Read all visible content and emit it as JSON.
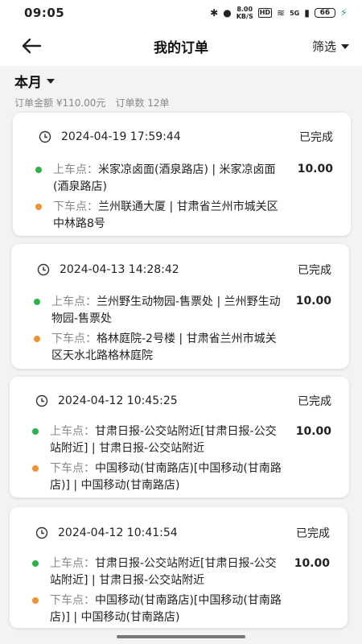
{
  "status_bar": {
    "time": "09:05",
    "net_speed_value": "8.00",
    "net_speed_unit": "KB/S",
    "hd_label": "HD",
    "signal_label": "5G",
    "battery_level": "66"
  },
  "header": {
    "title": "我的订单",
    "filter_label": "筛选"
  },
  "summary": {
    "month_label": "本月",
    "amount_text": "订单金额 ¥110.00元",
    "count_text": "订单数 12单"
  },
  "colors": {
    "pickup_dot": "#2bb34a",
    "dropoff_dot": "#f0922e"
  },
  "orders": [
    {
      "datetime": "2024-04-19 17:59:44",
      "status": "已完成",
      "pickup_label": "上车点：",
      "pickup": "米家凉卤面(酒泉路店) | 米家凉卤面(酒泉路店)",
      "dropoff_label": "下车点：",
      "dropoff": "兰州联通大厦 | 甘肃省兰州市城关区中林路8号",
      "price": "10.00"
    },
    {
      "datetime": "2024-04-13 14:28:42",
      "status": "已完成",
      "pickup_label": "上车点：",
      "pickup": "兰州野生动物园-售票处 | 兰州野生动物园-售票处",
      "dropoff_label": "下车点：",
      "dropoff": "格林庭院-2号楼 | 甘肃省兰州市城关区天水北路格林庭院",
      "price": "10.00"
    },
    {
      "datetime": "2024-04-12 10:45:25",
      "status": "已完成",
      "pickup_label": "上车点：",
      "pickup": "甘肃日报-公交站附近[甘肃日报-公交站附近] | 甘肃日报-公交站附近",
      "dropoff_label": "下车点：",
      "dropoff": "中国移动(甘南路店)[中国移动(甘南路店)] | 中国移动(甘南路店)",
      "price": "10.00"
    },
    {
      "datetime": "2024-04-12 10:41:54",
      "status": "已完成",
      "pickup_label": "上车点：",
      "pickup": "甘肃日报-公交站附近[甘肃日报-公交站附近] | 甘肃日报-公交站附近",
      "dropoff_label": "下车点：",
      "dropoff": "中国移动(甘南路店)[中国移动(甘南路店)] | 中国移动(甘南路店)",
      "price": "10.00"
    }
  ]
}
